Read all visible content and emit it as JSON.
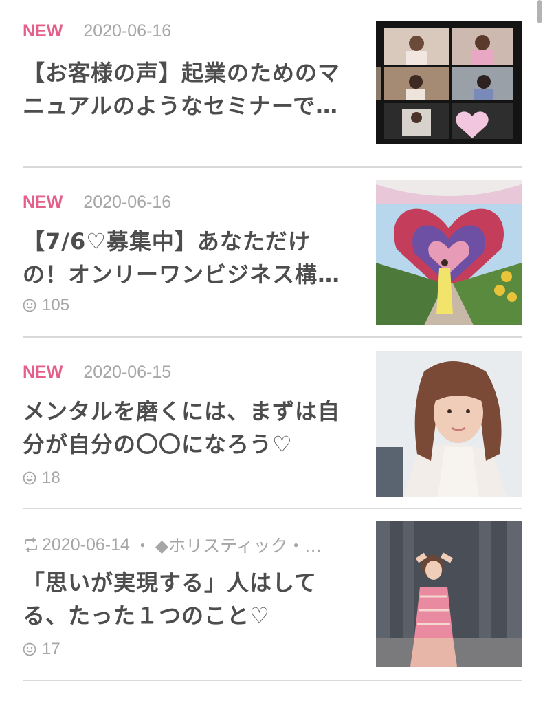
{
  "entries": [
    {
      "badge": "NEW",
      "date": "2020-06-16",
      "title": "【お客様の声】起業のためのマニュアルのようなセミナーで…",
      "thumbnail_icon": "video-call-grid-photo"
    },
    {
      "badge": "NEW",
      "date": "2020-06-16",
      "title": "【7/6♡募集中】あなただけの！オンリーワンビジネス構築…",
      "reactions": "105",
      "thumbnail_icon": "flower-heart-arch-photo"
    },
    {
      "badge": "NEW",
      "date": "2020-06-15",
      "title": "メンタルを磨くには、まずは自分が自分の〇〇になろう♡",
      "reactions": "18",
      "thumbnail_icon": "portrait-photo"
    },
    {
      "date": "2020-06-14",
      "separator": "・",
      "category": "◆ホリスティック・…",
      "title": "「思いが実現する」人はしてる、たった１つのこと♡",
      "reactions": "17",
      "thumbnail_icon": "woman-posing-photo"
    }
  ],
  "colors": {
    "badge": "#e4608a",
    "meta": "#a6a6a6",
    "title": "#4d4d4d",
    "divider": "#d9d9d9"
  }
}
